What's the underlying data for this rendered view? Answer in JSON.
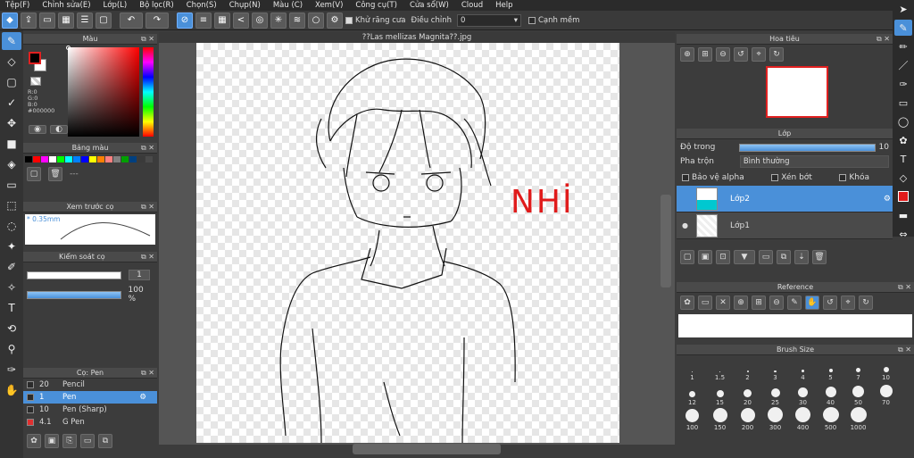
{
  "menu": [
    "Tệp(F)",
    "Chỉnh sửa(E)",
    "Lớp(L)",
    "Bộ lọc(R)",
    "Chọn(S)",
    "Chụp(N)",
    "Màu (C)",
    "Xem(V)",
    "Công cụ(T)",
    "Cửa sổ(W)",
    "Cloud",
    "Help"
  ],
  "toolbar": {
    "antialias_label": "Khử răng cưa",
    "adjust_label": "Điều chỉnh",
    "adjust_value": "0",
    "smooth_label": "Cạnh mềm"
  },
  "document_title": "??Las mellizas Magnita??.jpg",
  "color_panel": {
    "title": "Màu",
    "r": "R:0",
    "g": "G:0",
    "b": "B:0",
    "hex": "#000000",
    "foreground": "#000000",
    "background": "#ffffff"
  },
  "palette_panel": {
    "title": "Bảng màu",
    "colors": [
      "#000000",
      "#ff0000",
      "#ff00ff",
      "#ffffff",
      "#00ff00",
      "#00ffff",
      "#0080ff",
      "#0000ff",
      "#ffff00",
      "#ff8000",
      "#ff8080",
      "#808080",
      "#00a000",
      "#004080",
      "#3a3a3a",
      "#4a4a4a"
    ],
    "field_value": "---"
  },
  "preview_panel": {
    "title": "Xem trước cọ",
    "size": "0.35mm"
  },
  "brush_control": {
    "title": "Kiểm soát cọ",
    "size_value": "1",
    "opacity_value": "100 %",
    "opacity_fraction": 1.0
  },
  "brush_list": {
    "title": "Cọ: Pen",
    "items": [
      {
        "size": "20",
        "name": "Pencil",
        "color": "#2b2b2b"
      },
      {
        "size": "1",
        "name": "Pen",
        "color": "#2b2b2b"
      },
      {
        "size": "10",
        "name": "Pen (Sharp)",
        "color": "#2b2b2b"
      },
      {
        "size": "4.1",
        "name": "G Pen",
        "color": "#e03030"
      }
    ]
  },
  "navigator": {
    "title": "Hoa tiêu"
  },
  "layer_panel": {
    "title": "Lớp",
    "opacity_label": "Độ trong",
    "opacity_value": "10",
    "blend_label": "Pha trộn",
    "blend_value": "Bình thường",
    "protect_alpha": "Bảo vệ alpha",
    "clipping": "Xén bớt",
    "lock": "Khóa",
    "layers": [
      {
        "name": "Lớp2"
      },
      {
        "name": "Lớp1"
      }
    ]
  },
  "reference_panel": {
    "title": "Reference"
  },
  "brush_size_panel": {
    "title": "Brush Size",
    "sizes": [
      "1",
      "1.5",
      "2",
      "3",
      "4",
      "5",
      "7",
      "10",
      "12",
      "15",
      "20",
      "25",
      "30",
      "40",
      "50",
      "70",
      "100",
      "150",
      "200",
      "300",
      "400",
      "500",
      "1000"
    ]
  },
  "drawing_text": "NHİ",
  "accent_color": "#4a90d9"
}
